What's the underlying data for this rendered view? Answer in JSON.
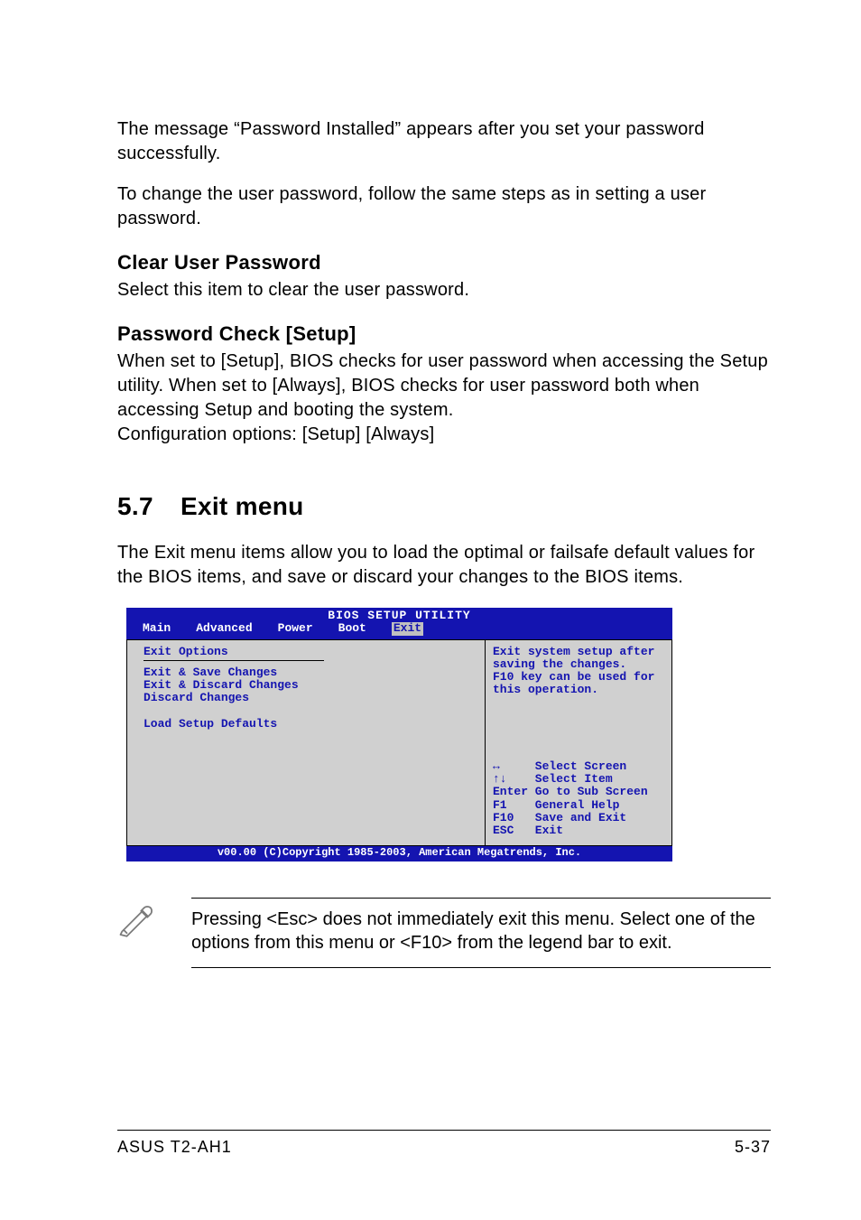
{
  "intro": {
    "p1": "The message “Password Installed” appears after you set your password successfully.",
    "p2": "To change the user password, follow the same steps as in setting a user password."
  },
  "clear_user": {
    "heading": "Clear User Password",
    "text": "Select this item to clear the user password."
  },
  "password_check": {
    "heading": "Password Check [Setup]",
    "text1": "When set to [Setup], BIOS checks for user password when accessing the Setup utility. When set to [Always], BIOS checks for user password both when accessing Setup and booting the system.",
    "text2": "Configuration options: [Setup] [Always]"
  },
  "section": {
    "num": "5.7",
    "title": "Exit menu",
    "intro": "The Exit menu items allow you to load the optimal or failsafe default values for the BIOS items, and save or discard your changes to the BIOS items."
  },
  "bios": {
    "title": "BIOS SETUP UTILITY",
    "tabs": [
      "Main",
      "Advanced",
      "Power",
      "Boot",
      "Exit"
    ],
    "selected_tab": "Exit",
    "left_heading": "Exit Options",
    "items": [
      "Exit & Save Changes",
      "Exit & Discard Changes",
      "Discard Changes",
      "",
      "Load Setup Defaults"
    ],
    "help_text": "Exit system setup after saving the changes.\nF10 key can be used for this operation.",
    "keys": [
      {
        "k": "↔",
        "d": "Select Screen"
      },
      {
        "k": "↑↓",
        "d": "Select Item"
      },
      {
        "k": "Enter",
        "d": "Go to Sub Screen"
      },
      {
        "k": "F1",
        "d": "General Help"
      },
      {
        "k": "F10",
        "d": "Save and Exit"
      },
      {
        "k": "ESC",
        "d": "Exit"
      }
    ],
    "footer": "v00.00 (C)Copyright 1985-2003, American Megatrends, Inc."
  },
  "note": {
    "text": "Pressing <Esc> does not immediately exit this menu. Select one of the options from this menu or <F10> from the legend bar to exit."
  },
  "footer": {
    "left": "ASUS T2-AH1",
    "right": "5-37"
  }
}
